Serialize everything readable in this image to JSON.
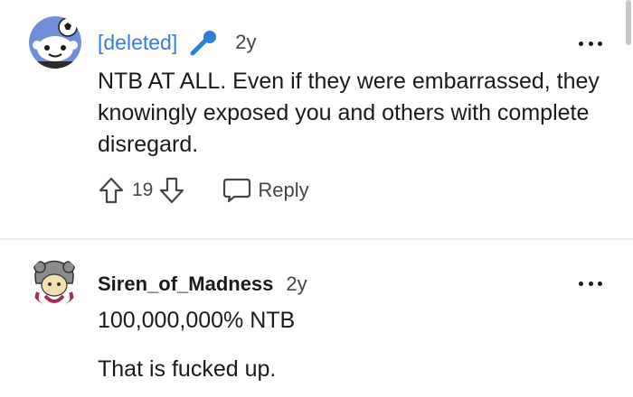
{
  "comments": [
    {
      "author": "[deleted]",
      "time": "2y",
      "flair_icon": "microphone-icon",
      "body": "NTB AT ALL. Even if they were embarrassed, they knowingly exposed you and others with complete disregard.",
      "score": "19",
      "reply_label": "Reply"
    },
    {
      "author": "Siren_of_Madness",
      "time": "2y",
      "body_lines": [
        "100,000,000% NTB",
        "That is fucked up."
      ]
    }
  ],
  "colors": {
    "deleted_author": "#3d7be0",
    "text": "#1a1a1b",
    "muted": "#454545",
    "divider": "#ececec"
  },
  "icons": [
    "snoo-avatar-icon",
    "microphone-icon",
    "more-options-icon",
    "upvote-icon",
    "downvote-icon",
    "reply-bubble-icon",
    "user-avatar-icon"
  ]
}
